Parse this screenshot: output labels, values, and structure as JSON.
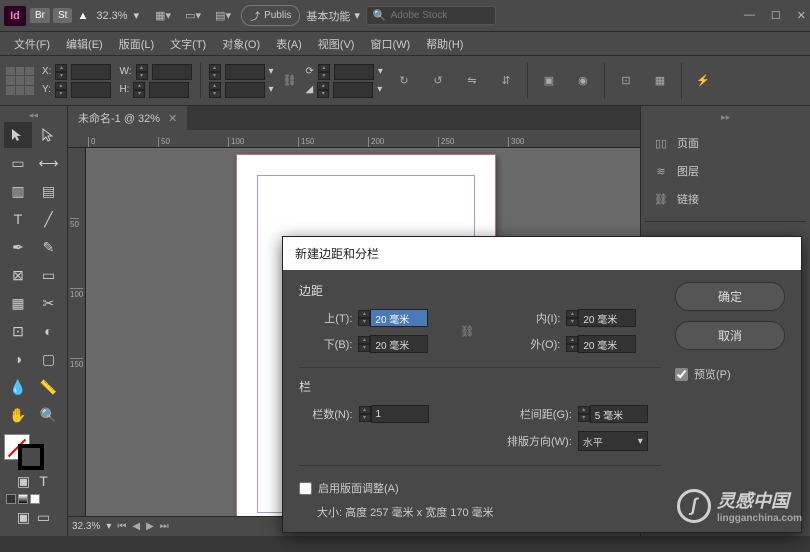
{
  "titlebar": {
    "logo": "Id",
    "br": "Br",
    "st": "St",
    "zoom": "32.3%",
    "publish_label": "Publis",
    "workspace": "基本功能",
    "search_placeholder": "Adobe Stock"
  },
  "menu": {
    "file": "文件(F)",
    "edit": "编辑(E)",
    "layout": "版面(L)",
    "type": "文字(T)",
    "object": "对象(O)",
    "table": "表(A)",
    "view": "视图(V)",
    "window": "窗口(W)",
    "help": "帮助(H)"
  },
  "control": {
    "x": "X:",
    "y": "Y:",
    "w": "W:",
    "h": "H:"
  },
  "doc_tab": "未命名-1 @ 32%",
  "ruler_marks": [
    "0",
    "50",
    "100",
    "150",
    "200",
    "250",
    "300"
  ],
  "ruler_v_marks": [
    "50",
    "100",
    "150"
  ],
  "panels": {
    "pages": "页面",
    "layers": "图层",
    "links": "链接"
  },
  "statusbar": {
    "zoom": "32.3%"
  },
  "dialog": {
    "title": "新建边距和分栏",
    "margins_label": "边距",
    "top": "上(T):",
    "bottom": "下(B):",
    "inside": "内(I):",
    "outside": "外(O):",
    "top_val": "20 毫米",
    "bottom_val": "20 毫米",
    "inside_val": "20 毫米",
    "outside_val": "20 毫米",
    "columns_label": "栏",
    "count": "栏数(N):",
    "count_val": "1",
    "gutter": "栏间距(G):",
    "gutter_val": "5 毫米",
    "direction": "排版方向(W):",
    "direction_val": "水平",
    "enable_layout": "启用版面调整(A)",
    "size": "大小: 高度 257 毫米 x 宽度 170 毫米",
    "ok": "确定",
    "cancel": "取消",
    "preview": "预览(P)"
  },
  "watermark": {
    "text": "灵感中国",
    "url": "lingganchina.com"
  }
}
